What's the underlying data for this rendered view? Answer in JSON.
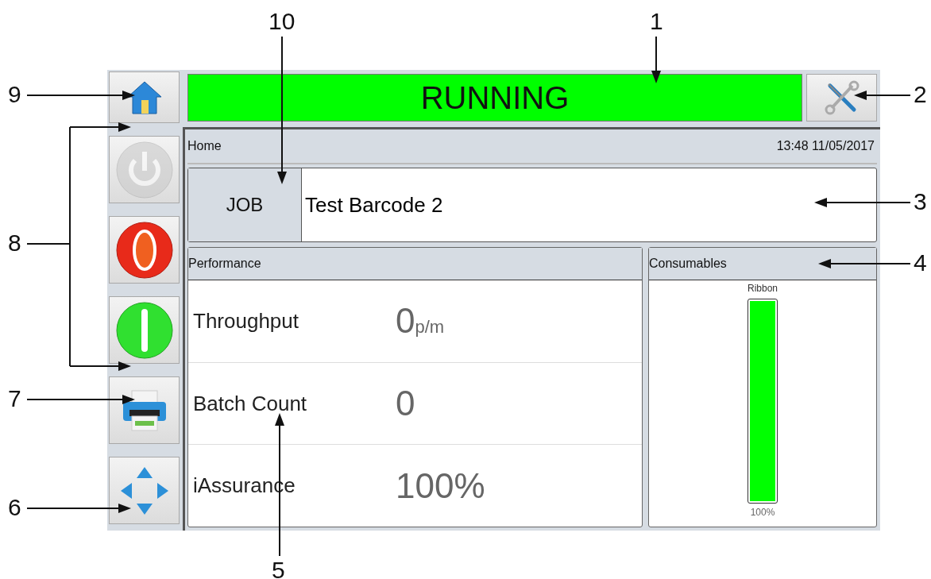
{
  "screen": {
    "home_button": {
      "kind": "home"
    },
    "status": {
      "text": "RUNNING"
    },
    "tools_button": {
      "kind": "tools"
    },
    "sidebar": [
      {
        "kind": "power",
        "disabled": true
      },
      {
        "kind": "stop",
        "disabled": false
      },
      {
        "kind": "start",
        "disabled": false
      },
      {
        "kind": "print",
        "disabled": false
      },
      {
        "kind": "navigate",
        "disabled": false
      }
    ],
    "breadcrumb": "Home",
    "datetime": "13:48 11/05/2017",
    "job": {
      "label": "JOB",
      "value": "Test Barcode 2"
    },
    "performance": {
      "title": "Performance",
      "rows": [
        {
          "label": "Throughput",
          "value": "0",
          "unit": "p/m"
        },
        {
          "label": "Batch Count",
          "value": "0"
        },
        {
          "label": "iAssurance",
          "value": "100%"
        }
      ]
    },
    "consumables": {
      "title": "Consumables",
      "items": [
        {
          "name": "Ribbon",
          "level": 1,
          "reading": "100%"
        }
      ]
    }
  },
  "callouts": [
    {
      "number": "10"
    },
    {
      "number": "1"
    },
    {
      "number": "9"
    },
    {
      "number": "2"
    },
    {
      "number": "8"
    },
    {
      "number": "3"
    },
    {
      "number": "4"
    },
    {
      "number": "7"
    },
    {
      "number": "6"
    },
    {
      "number": "5"
    }
  ]
}
